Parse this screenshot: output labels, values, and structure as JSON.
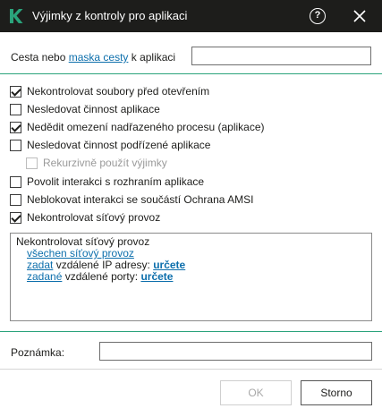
{
  "window": {
    "title": "Výjimky z kontroly pro aplikaci",
    "colors": {
      "titlebar": "#1d1d1b",
      "accent": "#2aa37b",
      "link": "#0d6fac",
      "logo": "#2aa37b"
    }
  },
  "path": {
    "label_before": "Cesta nebo ",
    "label_link": "maska cesty",
    "label_after": " k aplikaci",
    "value": ""
  },
  "options": [
    {
      "label": "Nekontrolovat soubory před otevřením",
      "checked": true,
      "disabled": false
    },
    {
      "label": "Nesledovat činnost aplikace",
      "checked": false,
      "disabled": false
    },
    {
      "label": "Nedědit omezení nadřazeného procesu (aplikace)",
      "checked": true,
      "disabled": false
    },
    {
      "label": "Nesledovat činnost podřízené aplikace",
      "checked": false,
      "disabled": false
    },
    {
      "label": "Rekurzivně použít výjimky",
      "checked": false,
      "disabled": true
    },
    {
      "label": "Povolit interakci s rozhraním aplikace",
      "checked": false,
      "disabled": false
    },
    {
      "label": "Neblokovat interakci se součástí Ochrana AMSI",
      "checked": false,
      "disabled": false
    },
    {
      "label": "Nekontrolovat síťový provoz",
      "checked": true,
      "disabled": false
    }
  ],
  "details": {
    "heading": "Nekontrolovat síťový provoz",
    "all_traffic_link": "všechen síťový provoz",
    "ip_link": "zadat",
    "ip_text": " vzdálené IP adresy: ",
    "ip_value_link": "určete",
    "port_link": "zadané",
    "port_text": " vzdálené porty: ",
    "port_value_link": "určete"
  },
  "note": {
    "label": "Poznámka:",
    "value": ""
  },
  "buttons": {
    "ok": "OK",
    "ok_enabled": false,
    "cancel": "Storno"
  },
  "icons": {
    "logo": "kaspersky-k-logo",
    "help": "help-icon",
    "close": "close-icon"
  }
}
